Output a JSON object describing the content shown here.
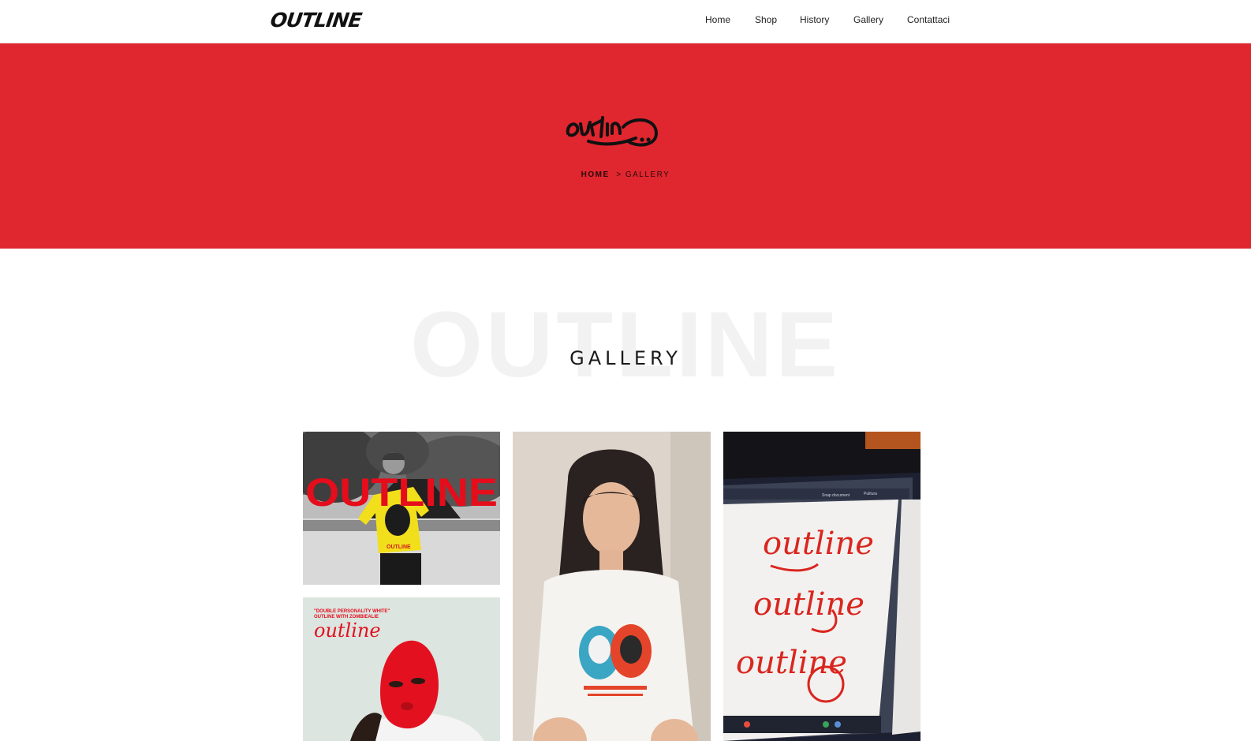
{
  "header": {
    "logo_text": "OUTLINE",
    "nav": [
      {
        "label": "Home"
      },
      {
        "label": "Shop"
      },
      {
        "label": "History"
      },
      {
        "label": "Gallery"
      },
      {
        "label": "Contattaci"
      }
    ]
  },
  "hero": {
    "background_color": "#e0262f",
    "logo_text": "outline",
    "breadcrumb": {
      "home": "HOME",
      "separator": ">",
      "current": "GALLERY"
    }
  },
  "gallery": {
    "background_word": "OUTLINE",
    "title": "GALLERY",
    "tiles": [
      {
        "overlay_text": "OUTLINE",
        "shirt_text": "OUTLINE"
      },
      {
        "overlay_text": ""
      },
      {
        "toolbar_labels": [
          "Snap document",
          "Pulitura"
        ],
        "tags": [
          "outline",
          "outline",
          "outline"
        ]
      },
      {
        "caption_line1": "\"DOUBLE PERSONALITY WHITE\"",
        "caption_line2": "OUTLINE WITH ZOMBIEALIE",
        "tag": "outline"
      }
    ]
  }
}
